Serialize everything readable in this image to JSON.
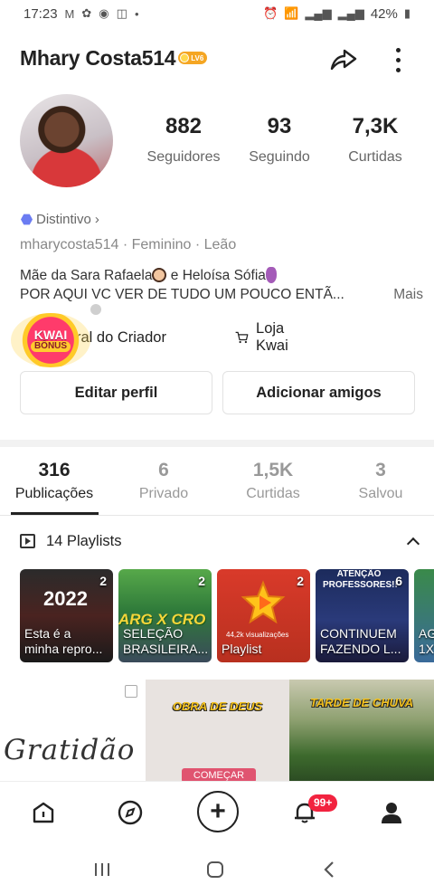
{
  "status_bar": {
    "time": "17:23",
    "notification_icons": [
      "gmail-icon",
      "photos-icon",
      "chrome-icon",
      "instagram-icon",
      "dot-icon"
    ],
    "system_icons": [
      "alarm-icon",
      "wifi-icon",
      "signal-icon",
      "signal-icon",
      "battery-icon"
    ],
    "battery": "42%"
  },
  "header": {
    "username": "Mhary Costa514",
    "level_badge": "LV6",
    "share_icon": "share-icon",
    "more_icon": "more-vertical-icon"
  },
  "profile": {
    "avatar": "profile-photo",
    "stats": [
      {
        "value": "882",
        "label": "Seguidores"
      },
      {
        "value": "93",
        "label": "Seguindo"
      },
      {
        "value": "7,3K",
        "label": "Curtidas"
      }
    ],
    "distintivo": "Distintivo",
    "meta": "mharycosta514 · Feminino · Leão",
    "bio_line1_a": "Mãe da Sara Rafaela",
    "bio_line1_b": " e Heloísa Sófia",
    "bio_line2": "POR AQUI VC VER DE TUDO UM POUCO ENTÃ...",
    "bio_more": "Mais"
  },
  "creator": {
    "central_label": "ral do Criador",
    "shop_label": "Loja Kwai",
    "kwai_bonus_line1": "KWAI",
    "kwai_bonus_line2": "BÔNUS"
  },
  "buttons": {
    "edit": "Editar perfil",
    "add": "Adicionar amigos"
  },
  "tabs": [
    {
      "value": "316",
      "label": "Publicações",
      "active": true
    },
    {
      "value": "6",
      "label": "Privado",
      "active": false
    },
    {
      "value": "1,5K",
      "label": "Curtidas",
      "active": false
    },
    {
      "value": "3",
      "label": "Salvou",
      "active": false
    }
  ],
  "playlists": {
    "header": "14 Playlists",
    "items": [
      {
        "count": "2",
        "title_line1": "Esta é a",
        "title_line2": "minha repro...",
        "overlay": "2022"
      },
      {
        "count": "2",
        "title_line1": "SELEÇÃO",
        "title_line2": "BRASILEIRA...",
        "overlay": "ARG X CRO"
      },
      {
        "count": "2",
        "title_line1": "Playlist",
        "title_line2": "",
        "overlay": "44,2k visualizações"
      },
      {
        "count": "6",
        "title_line1": "CONTINUEM",
        "title_line2": "FAZENDO L...",
        "overlay": "ATENÇÃO PROFESSORES!!"
      },
      {
        "count": "",
        "title_line1": "AG",
        "title_line2": "1X",
        "overlay": ""
      }
    ]
  },
  "grid": [
    {
      "text": "Gratidão"
    },
    {
      "text": "OBRA DE DEUS",
      "button": "COMEÇAR"
    },
    {
      "text": "TARDE DE CHUVA"
    }
  ],
  "bottom_nav": {
    "items": [
      "home-icon",
      "explore-icon",
      "create-icon",
      "notifications-icon",
      "profile-icon"
    ],
    "notifications_badge": "99+"
  },
  "system_nav": [
    "recent-apps-icon",
    "home-button-icon",
    "back-icon"
  ],
  "colors": {
    "text": "#222222",
    "muted": "#888888",
    "badge_red": "#f2233f",
    "level_gold": "#f5a623"
  }
}
